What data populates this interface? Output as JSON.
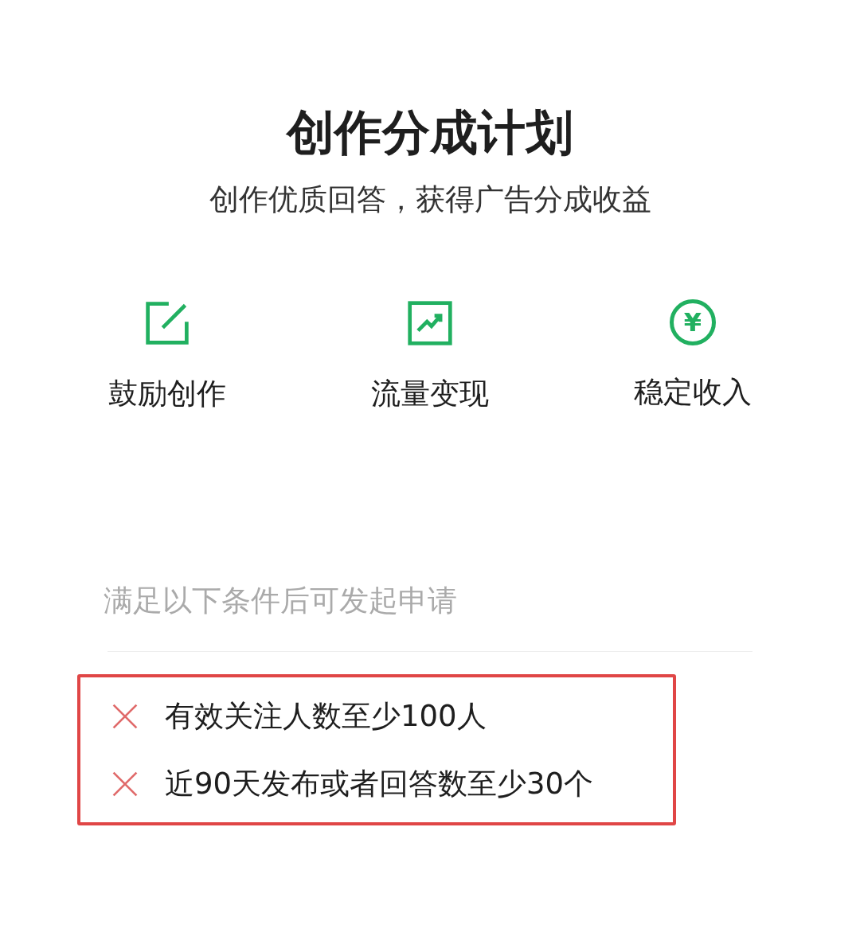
{
  "title": "创作分成计划",
  "subtitle": "创作优质回答，获得广告分成收益",
  "features": [
    {
      "kind": "edit",
      "label": "鼓励创作"
    },
    {
      "kind": "chart",
      "label": "流量变现"
    },
    {
      "kind": "money",
      "label": "稳定收入",
      "symbol": "¥"
    }
  ],
  "requirements": {
    "heading": "满足以下条件后可发起申请",
    "items": [
      {
        "text": "有效关注人数至少100人",
        "met": false
      },
      {
        "text": "近90天发布或者回答数至少30个",
        "met": false
      }
    ]
  }
}
